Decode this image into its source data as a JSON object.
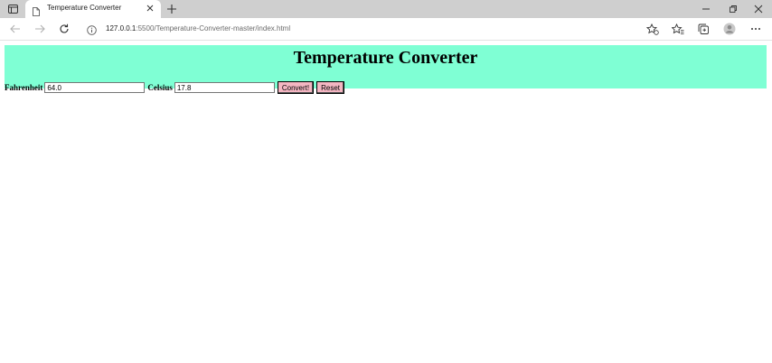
{
  "browser": {
    "tab_title": "Temperature Converter",
    "url_host": "127.0.0.1",
    "url_rest": ":5500/Temperature-Converter-master/index.html"
  },
  "page": {
    "heading": "Temperature Converter",
    "fahrenheit_label": "Fahrenheit",
    "fahrenheit_value": "64.0",
    "celsius_label": "Celsius",
    "celsius_value": "17.8",
    "convert_label": "Convert!",
    "reset_label": "Reset"
  },
  "colors": {
    "banner_bg": "#7fffd4",
    "button_bg": "#f4b6c2",
    "tabstrip_bg": "#cfcfcf"
  }
}
